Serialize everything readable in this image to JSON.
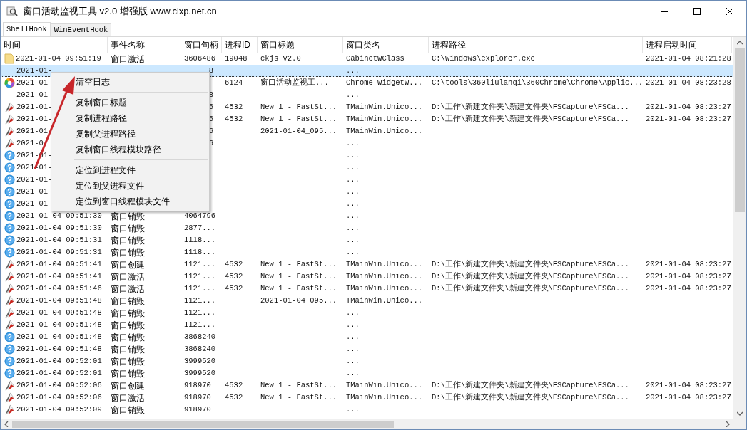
{
  "window": {
    "title": "窗口活动监视工具 v2.0 增强版 www.clxp.net.cn"
  },
  "tabs": [
    {
      "label": "ShellHook",
      "selected": true
    },
    {
      "label": "WinEventHook",
      "selected": false
    }
  ],
  "table": {
    "columns": [
      "时间",
      "事件名称",
      "窗口句柄",
      "进程ID",
      "窗口标题",
      "窗口类名",
      "进程路径",
      "进程启动时间"
    ],
    "rows": [
      {
        "kind": "folder",
        "selected": false,
        "time": "2021-01-04 09:51:19",
        "event": "窗口激活",
        "handle": "3606486",
        "pid": "19048",
        "title": "ckjs_v2.0",
        "class_name": "CabinetWClass",
        "path": "C:\\Windows\\explorer.exe",
        "start_time": "2021-01-04 08:21:28"
      },
      {
        "kind": "none",
        "selected": true,
        "time": "2021-01-",
        "handle": "8",
        "class_name": "..."
      },
      {
        "kind": "browser",
        "selected": false,
        "time": "2021-01-",
        "pid": "6124",
        "title": "窗口活动监视工...",
        "class_name": "Chrome_WidgetW...",
        "path": "C:\\tools\\360liulanqi\\360Chrome\\Chrome\\Applic...",
        "start_time": "2021-01-04 08:23:28"
      },
      {
        "kind": "none",
        "selected": false,
        "time": "2021-01-",
        "handle": "8",
        "class_name": "..."
      },
      {
        "kind": "capture",
        "selected": false,
        "time": "2021-01-",
        "handle": "6",
        "pid": "4532",
        "title": "New 1 - FastSt...",
        "class_name": "TMainWin.Unico...",
        "path": "D:\\工作\\新建文件夹\\新建文件夹\\FSCapture\\FSCa...",
        "start_time": "2021-01-04 08:23:27"
      },
      {
        "kind": "capture",
        "selected": false,
        "time": "2021-01-",
        "handle": "6",
        "pid": "4532",
        "title": "New 1 - FastSt...",
        "class_name": "TMainWin.Unico...",
        "path": "D:\\工作\\新建文件夹\\新建文件夹\\FSCapture\\FSCa...",
        "start_time": "2021-01-04 08:23:27"
      },
      {
        "kind": "capture",
        "selected": false,
        "time": "2021-01-",
        "handle": "6",
        "title": "2021-01-04_095...",
        "class_name": "TMainWin.Unico..."
      },
      {
        "kind": "capture",
        "selected": false,
        "time": "2021-0",
        "handle": "6",
        "class_name": "..."
      },
      {
        "kind": "unknown",
        "selected": false,
        "time": "2021-01-",
        "class_name": "..."
      },
      {
        "kind": "unknown",
        "selected": false,
        "time": "2021-01-",
        "class_name": "..."
      },
      {
        "kind": "unknown",
        "selected": false,
        "time": "2021-01-",
        "class_name": "..."
      },
      {
        "kind": "unknown",
        "selected": false,
        "time": "2021-01-",
        "class_name": "..."
      },
      {
        "kind": "unknown",
        "selected": false,
        "time": "2021-01-",
        "class_name": "..."
      },
      {
        "kind": "unknown",
        "selected": false,
        "time": "2021-01-04 09:51:30",
        "event": "窗口销毁",
        "handle": "4064796",
        "class_name": "..."
      },
      {
        "kind": "unknown",
        "selected": false,
        "time": "2021-01-04 09:51:30",
        "event": "窗口销毁",
        "handle": "2877...",
        "class_name": "..."
      },
      {
        "kind": "unknown",
        "selected": false,
        "time": "2021-01-04 09:51:31",
        "event": "窗口销毁",
        "handle": "1118...",
        "class_name": "..."
      },
      {
        "kind": "unknown",
        "selected": false,
        "time": "2021-01-04 09:51:31",
        "event": "窗口销毁",
        "handle": "1118...",
        "class_name": "..."
      },
      {
        "kind": "capture",
        "selected": false,
        "time": "2021-01-04 09:51:41",
        "event": "窗口创建",
        "handle": "1121...",
        "pid": "4532",
        "title": "New 1 - FastSt...",
        "class_name": "TMainWin.Unico...",
        "path": "D:\\工作\\新建文件夹\\新建文件夹\\FSCapture\\FSCa...",
        "start_time": "2021-01-04 08:23:27"
      },
      {
        "kind": "capture",
        "selected": false,
        "time": "2021-01-04 09:51:41",
        "event": "窗口激活",
        "handle": "1121...",
        "pid": "4532",
        "title": "New 1 - FastSt...",
        "class_name": "TMainWin.Unico...",
        "path": "D:\\工作\\新建文件夹\\新建文件夹\\FSCapture\\FSCa...",
        "start_time": "2021-01-04 08:23:27"
      },
      {
        "kind": "capture",
        "selected": false,
        "time": "2021-01-04 09:51:46",
        "event": "窗口激活",
        "handle": "1121...",
        "pid": "4532",
        "title": "New 1 - FastSt...",
        "class_name": "TMainWin.Unico...",
        "path": "D:\\工作\\新建文件夹\\新建文件夹\\FSCapture\\FSCa...",
        "start_time": "2021-01-04 08:23:27"
      },
      {
        "kind": "capture",
        "selected": false,
        "time": "2021-01-04 09:51:48",
        "event": "窗口销毁",
        "handle": "1121...",
        "title": "2021-01-04_095...",
        "class_name": "TMainWin.Unico..."
      },
      {
        "kind": "capture",
        "selected": false,
        "time": "2021-01-04 09:51:48",
        "event": "窗口销毁",
        "handle": "1121...",
        "class_name": "..."
      },
      {
        "kind": "capture",
        "selected": false,
        "time": "2021-01-04 09:51:48",
        "event": "窗口销毁",
        "handle": "1121...",
        "class_name": "..."
      },
      {
        "kind": "unknown",
        "selected": false,
        "time": "2021-01-04 09:51:48",
        "event": "窗口销毁",
        "handle": "3868240",
        "class_name": "..."
      },
      {
        "kind": "unknown",
        "selected": false,
        "time": "2021-01-04 09:51:48",
        "event": "窗口销毁",
        "handle": "3868240",
        "class_name": "..."
      },
      {
        "kind": "unknown",
        "selected": false,
        "time": "2021-01-04 09:52:01",
        "event": "窗口销毁",
        "handle": "3999520",
        "class_name": "..."
      },
      {
        "kind": "unknown",
        "selected": false,
        "time": "2021-01-04 09:52:01",
        "event": "窗口销毁",
        "handle": "3999520",
        "class_name": "..."
      },
      {
        "kind": "capture",
        "selected": false,
        "time": "2021-01-04 09:52:06",
        "event": "窗口创建",
        "handle": "918970",
        "pid": "4532",
        "title": "New 1 - FastSt...",
        "class_name": "TMainWin.Unico...",
        "path": "D:\\工作\\新建文件夹\\新建文件夹\\FSCapture\\FSCa...",
        "start_time": "2021-01-04 08:23:27"
      },
      {
        "kind": "capture",
        "selected": false,
        "time": "2021-01-04 09:52:06",
        "event": "窗口激活",
        "handle": "918970",
        "pid": "4532",
        "title": "New 1 - FastSt...",
        "class_name": "TMainWin.Unico...",
        "path": "D:\\工作\\新建文件夹\\新建文件夹\\FSCapture\\FSCa...",
        "start_time": "2021-01-04 08:23:27"
      },
      {
        "kind": "capture",
        "selected": false,
        "time": "2021-01-04 09:52:09",
        "event": "窗口销毁",
        "handle": "918970",
        "class_name": "..."
      }
    ]
  },
  "context_menu": {
    "groups": [
      [
        "清空日志"
      ],
      [
        "复制窗口标题",
        "复制进程路径",
        "复制父进程路径",
        "复制窗口线程模块路径"
      ],
      [
        "定位到进程文件",
        "定位到父进程文件",
        "定位到窗口线程模块文件"
      ]
    ]
  }
}
